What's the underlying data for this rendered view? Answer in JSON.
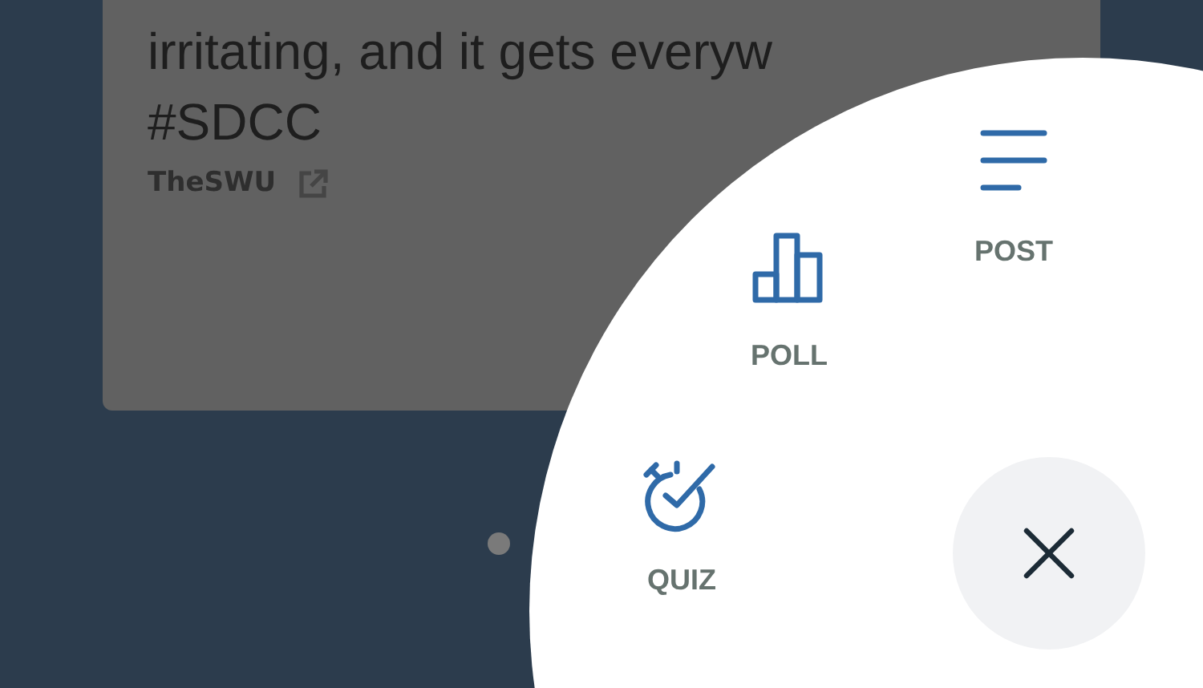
{
  "post_card": {
    "lines": [
      "irritating, and it gets everyw",
      "#SDCC"
    ],
    "source": "TheSWU"
  },
  "create_menu": {
    "items": [
      {
        "kind": "post",
        "label": "POST"
      },
      {
        "kind": "poll",
        "label": "POLL"
      },
      {
        "kind": "quiz",
        "label": "QUIZ"
      }
    ]
  }
}
